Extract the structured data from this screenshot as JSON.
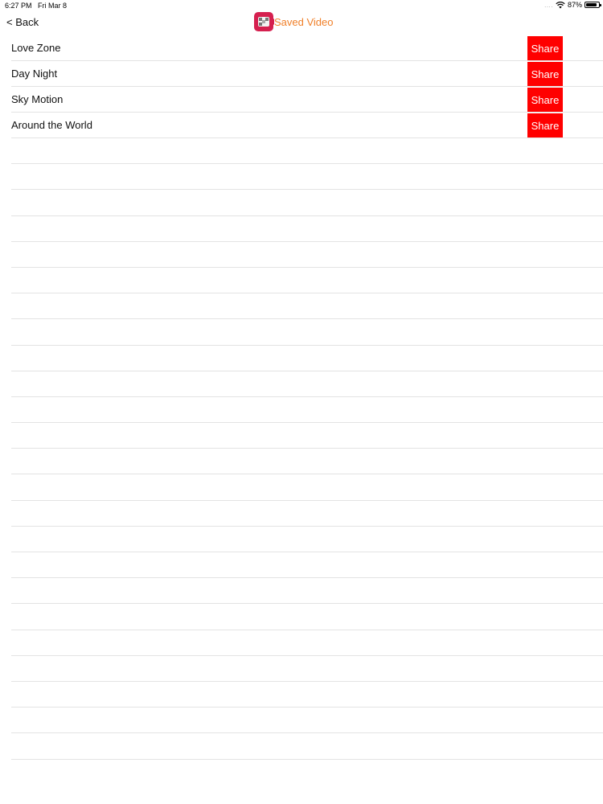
{
  "status_bar": {
    "time": "6:27 PM",
    "date": "Fri Mar 8",
    "signal": "....",
    "battery_percent_text": "87%",
    "battery_level": 0.87
  },
  "nav": {
    "back_label": "< Back",
    "title": "Saved Video",
    "title_color": "#f0802a",
    "logo_color": "#d5204f",
    "logo_icon": "video-camera-icon"
  },
  "list": {
    "share_color": "#ff0000",
    "items": [
      {
        "title": "Love Zone",
        "share_label": "Share"
      },
      {
        "title": "Day Night",
        "share_label": "Share"
      },
      {
        "title": "Sky Motion",
        "share_label": "Share"
      },
      {
        "title": "Around the World",
        "share_label": "Share"
      }
    ]
  }
}
